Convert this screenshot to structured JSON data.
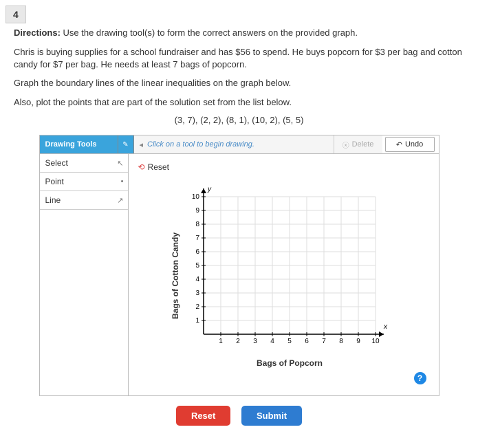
{
  "question_number": "4",
  "directions_label": "Directions:",
  "directions_text": " Use the drawing tool(s) to form the correct answers on the provided graph.",
  "para1": "Chris is buying supplies for a school fundraiser and has $56 to spend. He buys popcorn for $3 per bag and cotton candy for $7 per bag. He needs at least 7 bags of popcorn.",
  "para2": "Graph the boundary lines of the linear inequalities on the graph below.",
  "para3": "Also, plot the points that are part of the solution set from the list below.",
  "points_list": "(3, 7), (2, 2), (8, 1), (10, 2), (5, 5)",
  "tools": {
    "header": "Drawing Tools",
    "hint": "Click on a tool to begin drawing.",
    "delete": "Delete",
    "undo": "Undo",
    "reset_tool": "Reset",
    "items": [
      {
        "label": "Select"
      },
      {
        "label": "Point"
      },
      {
        "label": "Line"
      }
    ]
  },
  "chart_data": {
    "type": "scatter",
    "title": "",
    "xlabel": "Bags of Popcorn",
    "ylabel": "Bags of Cotton Candy",
    "xlim": [
      0,
      10
    ],
    "ylim": [
      0,
      10
    ],
    "x_ticks": [
      1,
      2,
      3,
      4,
      5,
      6,
      7,
      8,
      9,
      10
    ],
    "y_ticks": [
      1,
      2,
      3,
      4,
      5,
      6,
      7,
      8,
      9,
      10
    ],
    "x_axis_var": "x",
    "y_axis_var": "y",
    "series": []
  },
  "buttons": {
    "reset": "Reset",
    "submit": "Submit"
  },
  "help": "?"
}
